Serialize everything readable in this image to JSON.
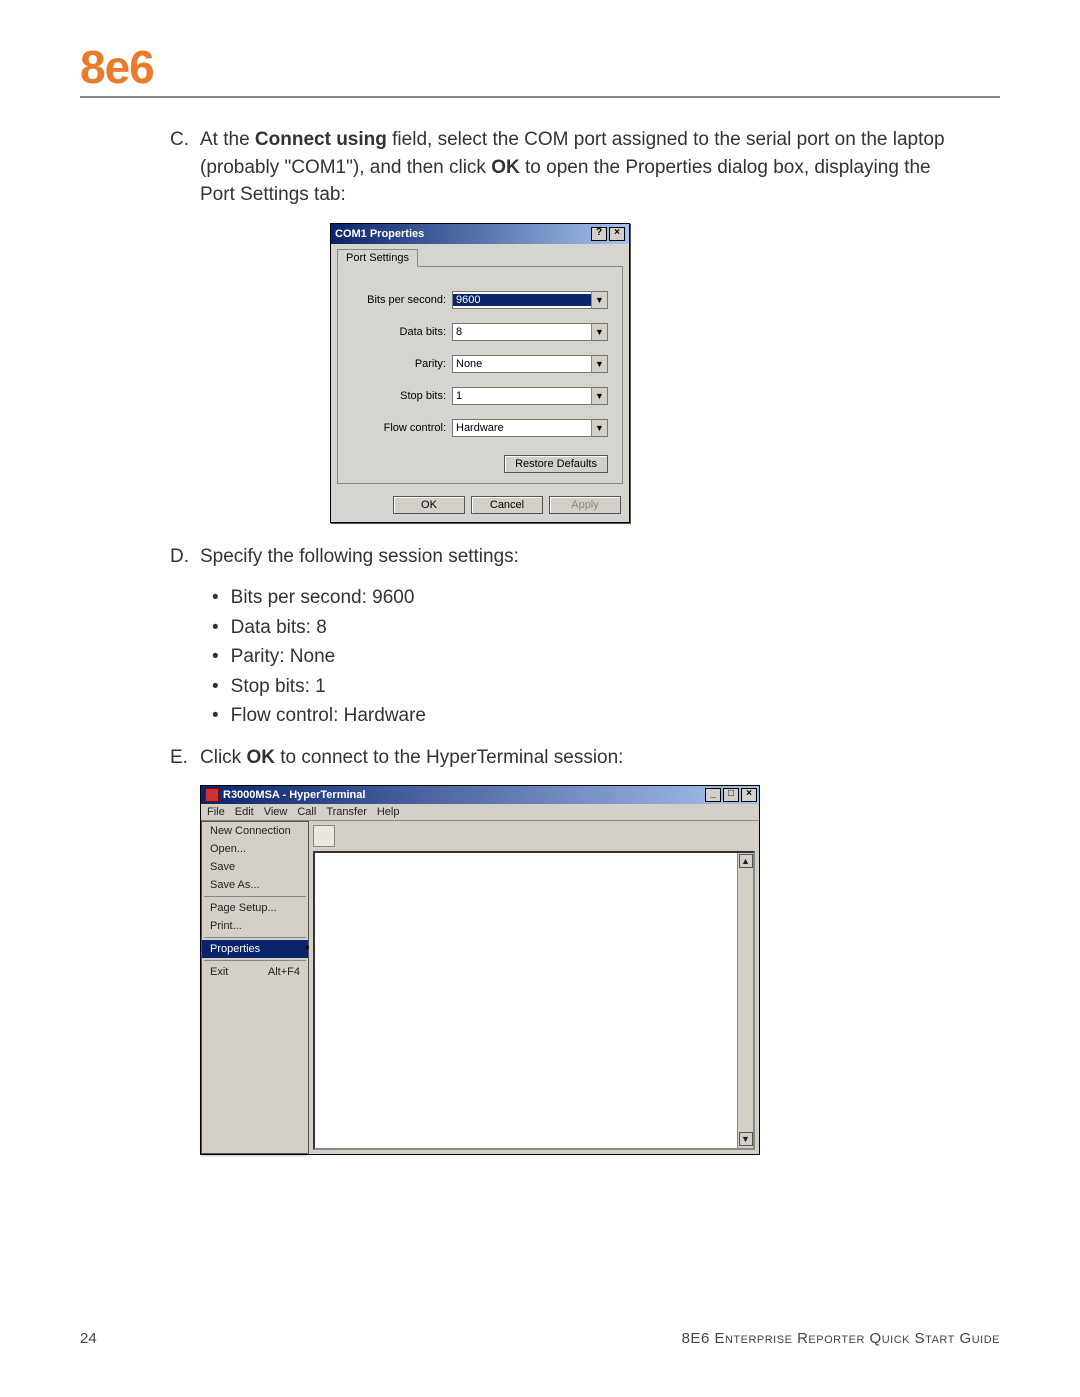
{
  "brand": "8e6",
  "stepC": {
    "label": "C.",
    "pre": "At the ",
    "bold1": "Connect using",
    "mid": " field, select the COM port assigned to the serial port on the laptop (probably \"COM1\"), and then click ",
    "bold2": "OK",
    "post": " to open the Properties dialog box, displaying the Port Settings tab:"
  },
  "dlg1": {
    "title": "COM1 Properties",
    "help_btn": "?",
    "close_btn": "×",
    "tab": "Port Settings",
    "fields": {
      "bps": {
        "label": "Bits per second:",
        "value": "9600"
      },
      "db": {
        "label": "Data bits:",
        "value": "8"
      },
      "par": {
        "label": "Parity:",
        "value": "None"
      },
      "sb": {
        "label": "Stop bits:",
        "value": "1"
      },
      "fc": {
        "label": "Flow control:",
        "value": "Hardware"
      }
    },
    "restore": "Restore Defaults",
    "ok": "OK",
    "cancel": "Cancel",
    "apply": "Apply"
  },
  "stepD": {
    "label": "D.",
    "text": "Specify the following session settings:",
    "bullets": [
      "Bits per second: 9600",
      "Data bits: 8",
      "Parity: None",
      "Stop bits: 1",
      "Flow control: Hardware"
    ]
  },
  "stepE": {
    "label": "E.",
    "pre": "Click ",
    "bold": "OK",
    "post": " to connect to the HyperTerminal session:"
  },
  "ht": {
    "title": "R3000MSA - HyperTerminal",
    "min_btn": "_",
    "max_btn": "□",
    "close_btn": "×",
    "menubar": [
      "File",
      "Edit",
      "View",
      "Call",
      "Transfer",
      "Help"
    ],
    "menu": {
      "new": "New Connection",
      "open": "Open...",
      "save": "Save",
      "saveas": "Save As...",
      "pagesetup": "Page Setup...",
      "print": "Print...",
      "properties": "Properties",
      "exit": "Exit",
      "exit_accel": "Alt+F4"
    },
    "scroll_up": "▲",
    "scroll_down": "▼"
  },
  "footer": {
    "page": "24",
    "guide_prefix": "8E6 ",
    "guide": "Enterprise Reporter Quick Start Guide"
  }
}
